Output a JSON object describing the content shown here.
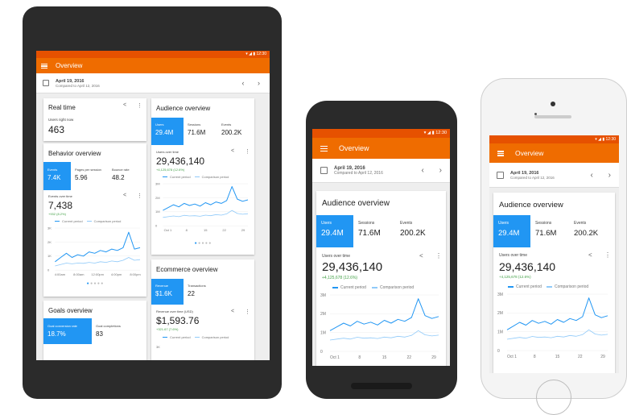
{
  "app": {
    "title": "Overview",
    "status_time": "12:30",
    "date": "April 19, 2016",
    "compared": "Compared to April 12, 2016",
    "prev": "‹",
    "next": "›"
  },
  "realtime": {
    "title": "Real time",
    "label": "Users right now",
    "value": "463"
  },
  "behavior": {
    "title": "Behavior overview",
    "metrics": [
      {
        "label": "Events",
        "value": "7.4K"
      },
      {
        "label": "Pages per session",
        "value": "5.96"
      },
      {
        "label": "Bounce rate",
        "value": "48.2"
      }
    ],
    "chart_label": "Events over time",
    "chart_value": "7,438",
    "change": "+932 (8.2%)",
    "legend_current": "Current period",
    "legend_compare": "Comparison period",
    "yticks": [
      "3K",
      "2K",
      "1K",
      "0"
    ],
    "xticks": [
      "4:00am",
      "8:00am",
      "12:00pm",
      "4:00pm",
      "8:00pm"
    ]
  },
  "goals": {
    "title": "Goals overview",
    "metrics": [
      {
        "label": "Goal conversion rate",
        "value": "18.7%"
      },
      {
        "label": "Goal completions",
        "value": "83"
      }
    ]
  },
  "audience": {
    "title": "Audience overview",
    "metrics": [
      {
        "label": "Users",
        "value": "29.4M"
      },
      {
        "label": "Sessions",
        "value": "71.6M"
      },
      {
        "label": "Events",
        "value": "200.2K"
      }
    ],
    "chart_label": "Users over time",
    "chart_value": "29,436,140",
    "change": "+4,125,678 (12.6%)",
    "legend_current": "Current period",
    "legend_compare": "Comparison period",
    "yticks": [
      "3M",
      "2M",
      "1M",
      "0"
    ],
    "xticks": [
      "Oct 1",
      "8",
      "15",
      "22",
      "29"
    ]
  },
  "ecommerce": {
    "title": "Ecommerce overview",
    "metrics": [
      {
        "label": "Revenue",
        "value": "$1.6K"
      },
      {
        "label": "Transactions",
        "value": "22"
      }
    ],
    "chart_label": "Revenue over time (USD)",
    "chart_value": "$1,593.76",
    "change": "+321.67 (7.6%)",
    "legend_current": "Current period",
    "legend_compare": "Comparison period",
    "ytick_top": "3K"
  },
  "colors": {
    "appbar": "#ef6c00",
    "statusbar": "#e65100",
    "active_metric": "#2196f3",
    "current_line": "#2196f3",
    "comparison_line": "#90caf9",
    "positive": "#43a047"
  },
  "icons": [
    "menu-icon",
    "calendar-icon",
    "share-icon",
    "more-vert-icon",
    "wifi-icon",
    "signal-icon",
    "battery-icon"
  ],
  "chart_data": [
    {
      "type": "line",
      "x": [
        "4:00am",
        "8:00am",
        "12:00pm",
        "4:00pm",
        "8:00pm"
      ],
      "ylim": [
        0,
        3000
      ],
      "series": [
        {
          "name": "Current period",
          "values": [
            600,
            900,
            1200,
            900,
            1100,
            1000,
            1300,
            1200,
            1400,
            1300,
            1500,
            1400,
            1600,
            2700,
            1500,
            1600
          ]
        },
        {
          "name": "Comparison period",
          "values": [
            300,
            400,
            500,
            450,
            500,
            480,
            550,
            500,
            600,
            550,
            650,
            600,
            700,
            900,
            700,
            750
          ]
        }
      ]
    },
    {
      "type": "line",
      "x": [
        "Oct 1",
        "8",
        "15",
        "22",
        "29"
      ],
      "ylim": [
        0,
        3000000
      ],
      "series": [
        {
          "name": "Current period",
          "values": [
            1100000,
            1300000,
            1500000,
            1350000,
            1600000,
            1450000,
            1550000,
            1400000,
            1650000,
            1500000,
            1700000,
            1600000,
            1800000,
            2800000,
            1900000,
            1750000,
            1850000
          ]
        },
        {
          "name": "Comparison period",
          "values": [
            600000,
            650000,
            700000,
            650000,
            750000,
            700000,
            720000,
            680000,
            760000,
            720000,
            800000,
            760000,
            850000,
            1100000,
            880000,
            820000,
            860000
          ]
        }
      ]
    }
  ]
}
